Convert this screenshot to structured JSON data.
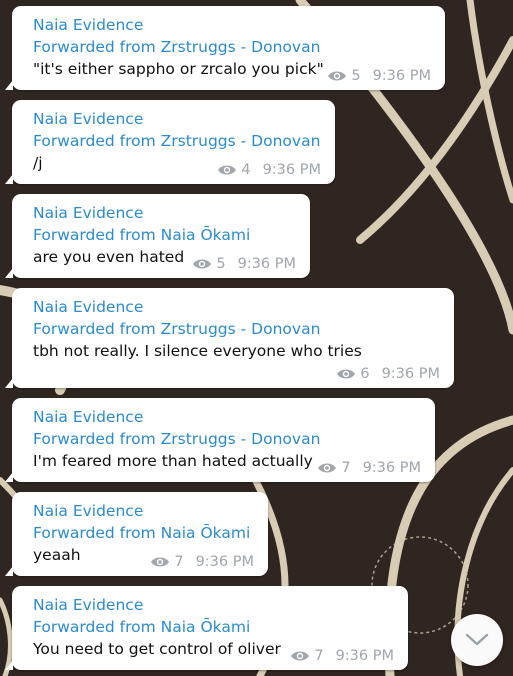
{
  "colors": {
    "link_blue": "#2b8ccc",
    "meta_gray": "#a0a6ac",
    "background": "#2a221d"
  },
  "messages": [
    {
      "channel": "Naia Evidence",
      "forwarded": "Forwarded from Zrstruggs - Donovan",
      "text": "\"it's either sappho or zrcalo you pick\"",
      "views": "5",
      "time": "9:36 PM"
    },
    {
      "channel": "Naia Evidence",
      "forwarded": "Forwarded from Zrstruggs - Donovan",
      "text": "/j",
      "views": "4",
      "time": "9:36 PM"
    },
    {
      "channel": "Naia Evidence",
      "forwarded": "Forwarded from Naia Ōkami",
      "text": "are you even hated",
      "views": "5",
      "time": "9:36 PM"
    },
    {
      "channel": "Naia Evidence",
      "forwarded": "Forwarded from Zrstruggs - Donovan",
      "text": "tbh not really. I silence everyone who tries",
      "views": "6",
      "time": "9:36 PM"
    },
    {
      "channel": "Naia Evidence",
      "forwarded": "Forwarded from Zrstruggs - Donovan",
      "text": "I'm feared more than hated actually",
      "views": "7",
      "time": "9:36 PM"
    },
    {
      "channel": "Naia Evidence",
      "forwarded": "Forwarded from Naia Ōkami",
      "text": "yeaah",
      "views": "7",
      "time": "9:36 PM"
    },
    {
      "channel": "Naia Evidence",
      "forwarded": "Forwarded from Naia Ōkami",
      "text": "You need to get control of oliver",
      "views": "7",
      "time": "9:36 PM"
    }
  ],
  "scroll_button": {
    "icon": "chevron-down-icon"
  }
}
